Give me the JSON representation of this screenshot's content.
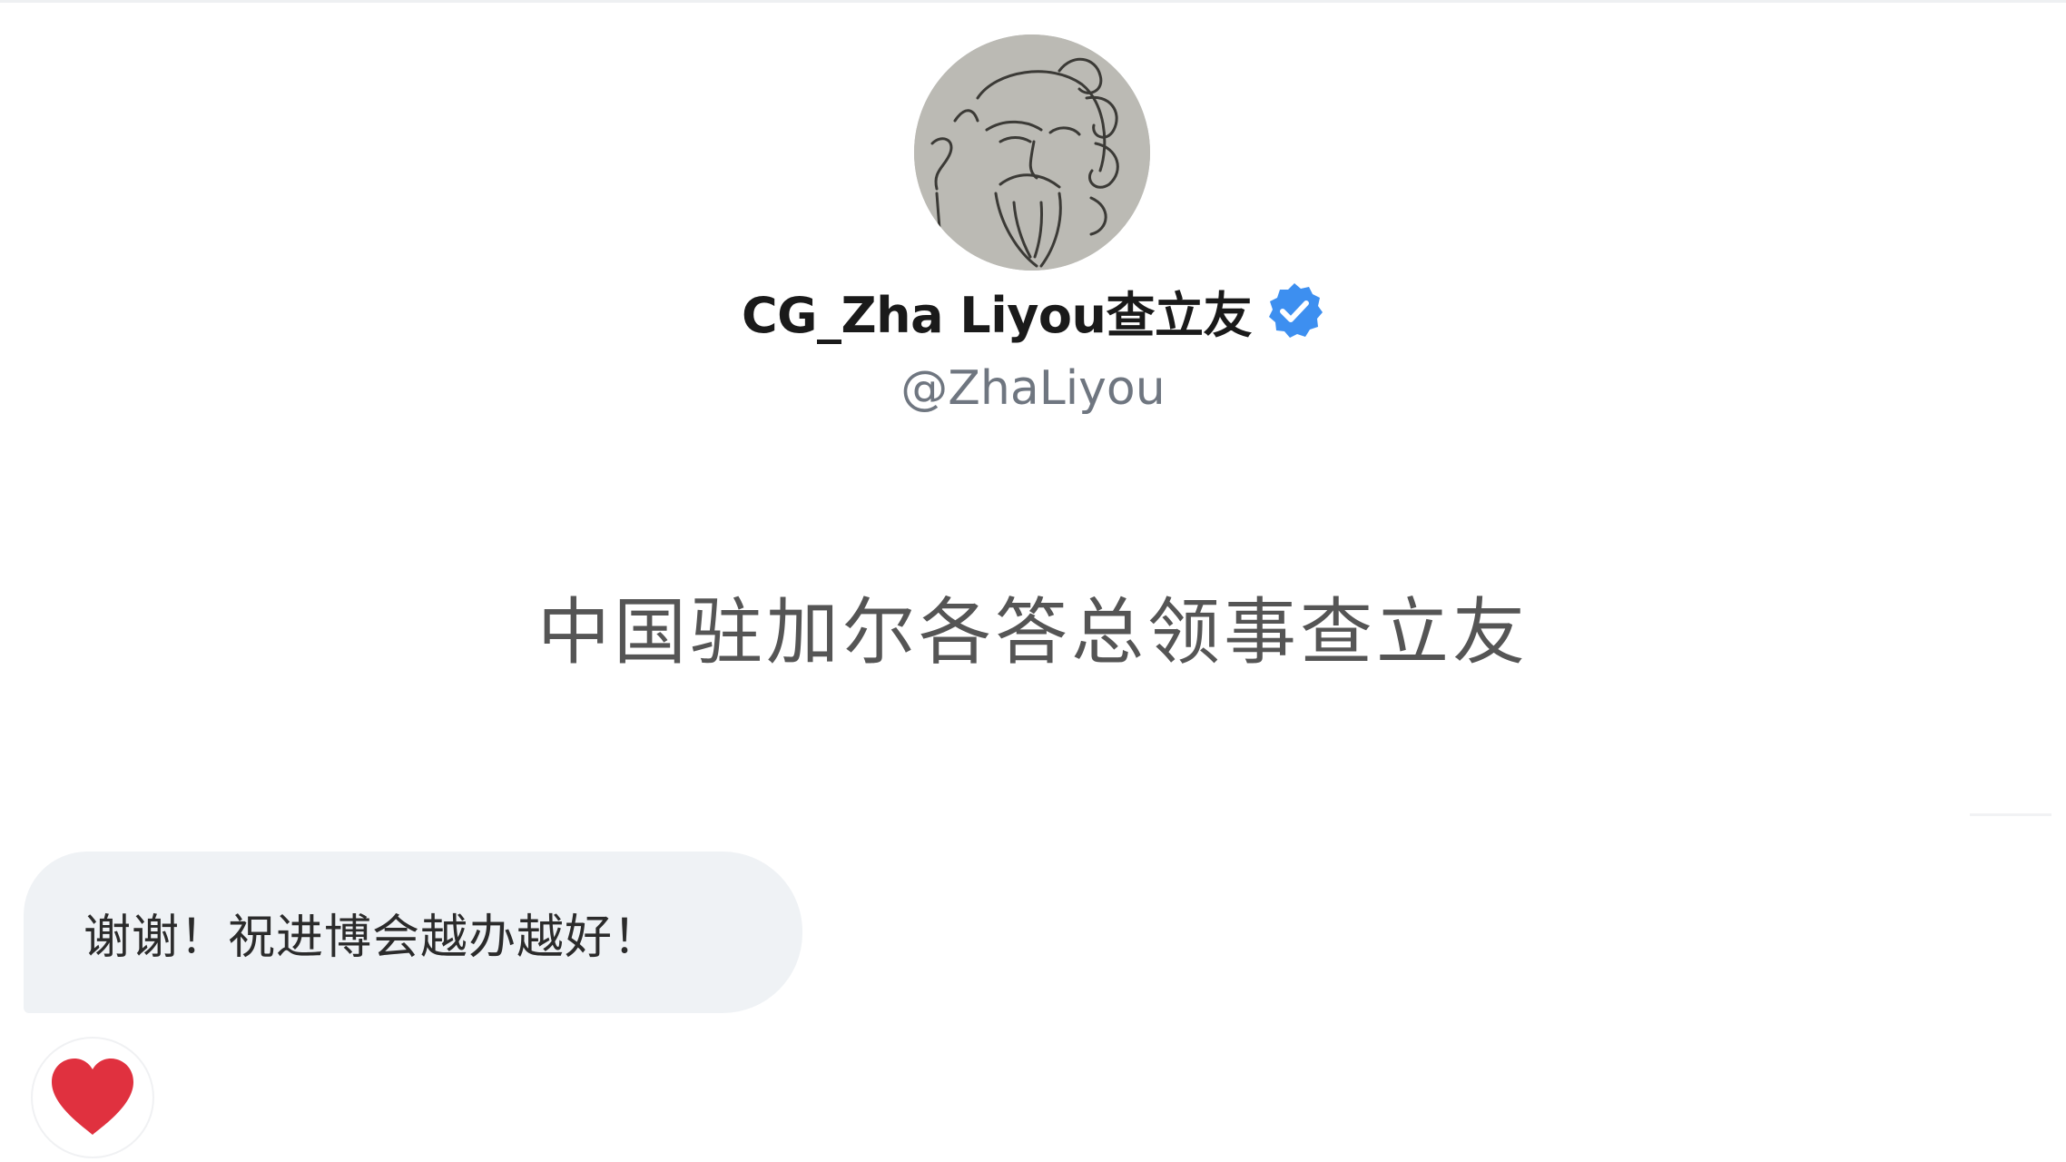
{
  "profile": {
    "display_name": "CG_Zha Liyou查立友",
    "handle": "@ZhaLiyou",
    "bio": "中国驻加尔各答总领事查立友",
    "verified": true,
    "avatar_icon": "sketched-deity-portrait"
  },
  "message": {
    "text": "谢谢！祝进博会越办越好！",
    "reaction_icon": "heart-icon"
  },
  "colors": {
    "verified_badge": "#3d8ff0",
    "heart": "#e0313f",
    "bubble": "#eff2f5",
    "handle_text": "#6f7680"
  }
}
